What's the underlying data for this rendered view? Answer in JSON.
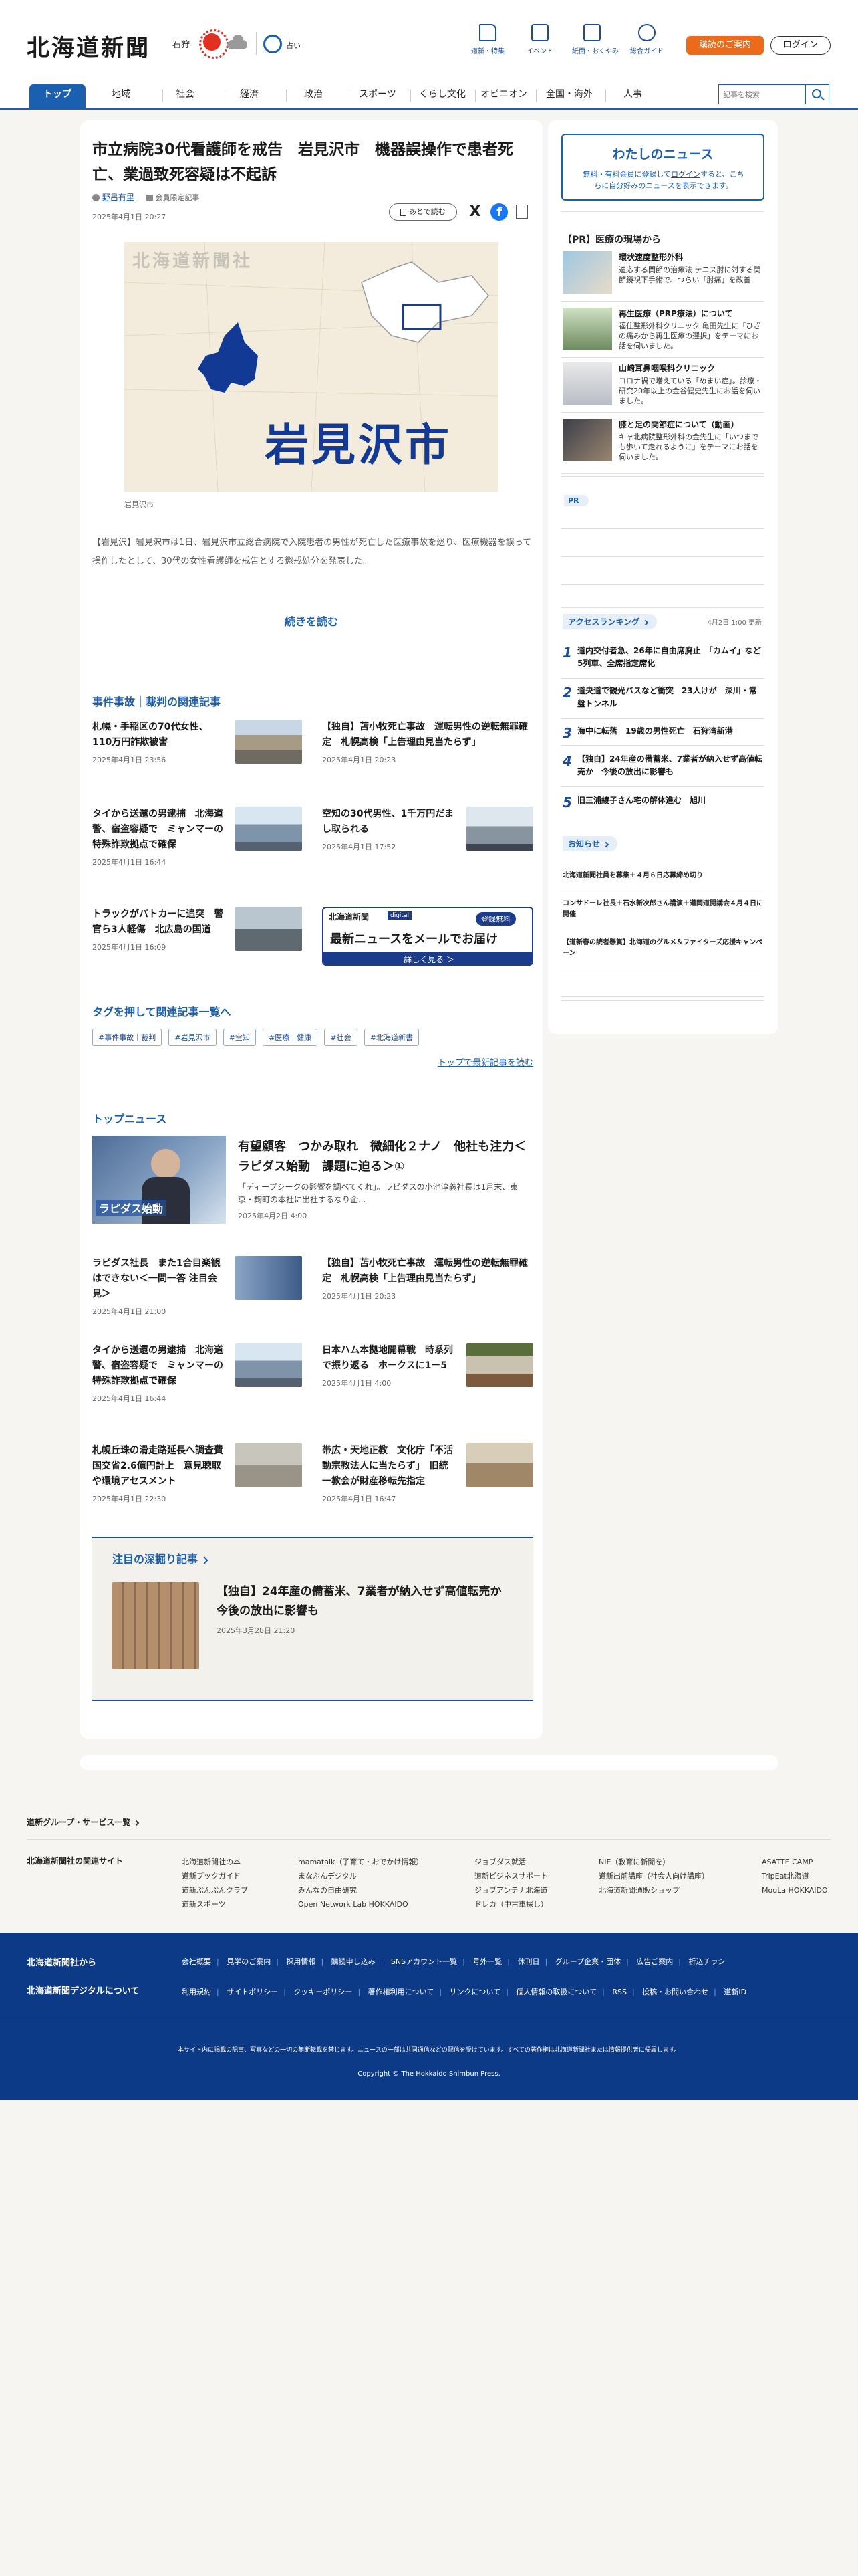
{
  "header": {
    "logo": "北海道新聞",
    "city": "石狩",
    "fortune": "占い",
    "icons": [
      "道新・特集",
      "イベント",
      "紙面・おくやみ",
      "総合ガイド"
    ],
    "subscribe": "購読のご案内",
    "login": "ログイン"
  },
  "nav": {
    "items": [
      "トップ",
      "地域",
      "社会",
      "経済",
      "政治",
      "スポーツ",
      "くらし文化",
      "オピニオン",
      "全国・海外",
      "人事"
    ],
    "search_placeholder": "記事を検索"
  },
  "article": {
    "title": "市立病院30代看護師を戒告　岩見沢市　機器誤操作で患者死亡、業過致死容疑は不起訴",
    "author": "野呂有里",
    "member": "会員限定記事",
    "date": "2025年4月1日 20:27",
    "save": "あとで読む",
    "image_watermark": "北海道新聞社",
    "image_text": "岩見沢市",
    "caption": "岩見沢市",
    "lead": "【岩見沢】岩見沢市は1日、岩見沢市立総合病院で入院患者の男性が死亡した医療事故を巡り、医療機器を誤って操作したとして、30代の女性看護師を戒告とする懲戒処分を発表した。",
    "read_more": "続きを読む"
  },
  "related": {
    "heading": "事件事故｜裁判の関連記事",
    "items": [
      {
        "title": "札幌・手稲区の70代女性、110万円詐欺被害",
        "date": "2025年4月1日 23:56"
      },
      {
        "title": "【独自】苫小牧死亡事故　運転男性の逆転無罪確定　札幌高検「上告理由見当たらず」",
        "date": "2025年4月1日 20:23"
      },
      {
        "title": "タイから送還の男逮捕　北海道警、宿盗容疑で　ミャンマーの特殊詐欺拠点で確保",
        "date": "2025年4月1日 16:44"
      },
      {
        "title": "空知の30代男性、1千万円だまし取られる",
        "date": "2025年4月1日 17:52"
      },
      {
        "title": "トラックがパトカーに追突　警官ら3人軽傷　北広島の国道",
        "date": "2025年4月1日 16:09"
      }
    ],
    "banner_logo": "北海道新聞",
    "banner_tag": "digital",
    "banner_badge": "登録無料",
    "banner_title": "最新ニュースをメールでお届け",
    "banner_btn": "詳しく見る ＞"
  },
  "tags": {
    "heading": "タグを押して関連記事一覧へ",
    "items": [
      "#事件事故｜裁判",
      "#岩見沢市",
      "#空知",
      "#医療｜健康",
      "#社会",
      "#北海道新書"
    ],
    "more": "トップで最新記事を読む"
  },
  "top_news": {
    "heading": "トップニュース",
    "lead_title": "有望顧客　つかみ取れ　微細化２ナノ　他社も注力＜ラピダス始動　課題に迫る＞①",
    "lead_text": "「ディープシークの影響を調べてくれ」。ラピダスの小池淳義社長は1月末、東京・麹町の本社に出社するなり企...",
    "lead_date": "2025年4月2日 4:00",
    "thumb_text": "ラピダス始動",
    "items": [
      {
        "title": "ラピダス社長　また1合目楽観はできない＜一問一答 注目会見＞",
        "date": "2025年4月1日 21:00"
      },
      {
        "title": "【独自】苫小牧死亡事故　運転男性の逆転無罪確定　札幌高検「上告理由見当たらず」",
        "date": "2025年4月1日 20:23"
      },
      {
        "title": "タイから送還の男逮捕　北海道警、宿盗容疑で　ミャンマーの特殊詐欺拠点で確保",
        "date": "2025年4月1日 16:44"
      },
      {
        "title": "日本ハム本拠地開幕戦　時系列で振り返る　ホークスに1－5",
        "date": "2025年4月1日 4:00"
      },
      {
        "title": "札幌丘珠の滑走路延長へ調査費　国交省2.6億円計上　意見聴取や環境アセスメント",
        "date": "2025年4月1日 22:30"
      },
      {
        "title": "帯広・天地正教　文化庁「不活動宗教法人に当たらず」　旧統一教会が財産移転先指定",
        "date": "2025年4月1日 16:47"
      }
    ]
  },
  "deep": {
    "heading": "注目の深掘り記事",
    "title": "【独自】24年産の備蓄米、7業者が納入せず高値転売か　今後の放出に影響も",
    "date": "2025年3月28日 21:20"
  },
  "sidebar": {
    "my_news_title": "わたしのニュース",
    "my_news_text1": "無料・有料会員に登録して",
    "my_news_login": "ログイン",
    "my_news_text2": "すると、こちらに自分好みのニュースを表示できます。",
    "pr_heading": "【PR】医療の現場から",
    "pr_items": [
      {
        "name": "環状速度整形外科",
        "desc": "適応する関節の治療法 テニス肘に対する関節鏡視下手術で、つらい「肘痛」を改善"
      },
      {
        "name": "再生医療（PRP療法）について",
        "desc": "福住整形外科クリニック 亀田先生に「ひざの痛みから再生医療の選択」をテーマにお話を伺いました。"
      },
      {
        "name": "山崎耳鼻咽喉科クリニック",
        "desc": "コロナ禍で増えている「めまい症」。診療・研究20年以上の金谷健史先生にお話を伺いました。"
      },
      {
        "name": "膝と足の関節症について（動画）",
        "desc": "キャ北病院整形外科の金先生に「いつまでも歩いて走れるように」をテーマにお話を伺いました。"
      }
    ],
    "pr_label": "PR",
    "ranking_heading": "アクセスランキング",
    "ranking_date": "4月2日 1:00 更新",
    "ranking": [
      "道内交付者急、26年に自由席廃止　「カムイ」など5列車、全席指定席化",
      "道央道で観光バスなど衝突　23人けが　深川・常盤トンネル",
      "海中に転落　19歳の男性死亡　石狩湾新港",
      "【独自】24年産の備蓄米、7業者が納入せず高値転売か　今後の放出に影響も",
      "旧三浦綾子さん宅の解体進む　旭川"
    ],
    "notice_heading": "お知らせ",
    "notices": [
      "北海道新聞社員を募集＋４月６日応募締め切り",
      "コンサドーレ社長＋石水新次郎さん講演＋道岡道開講会４月４日に開催",
      "【道新春の読者懸賞】北海道のグルメ＆ファイターズ応援キャンペーン"
    ]
  },
  "footer": {
    "group_link": "道新グループ・サービス一覧",
    "related_heading": "北海道新聞社の関連サイト",
    "related_cols": [
      [
        "北海道新聞社の本",
        "道新ブックガイド",
        "道新ぶんぶんクラブ",
        "道新スポーツ"
      ],
      [
        "mamatalk（子育て・おでかけ情報）",
        "まなぶんデジタル",
        "みんなの自由研究",
        "Open Network Lab HOKKAIDO"
      ],
      [
        "ジョブダス就活",
        "道新ビジネスサポート",
        "ジョブアンテナ北海道",
        "ドレカ（中古車探し）"
      ],
      [
        "NIE（教育に新聞を）",
        "道新出前講座（社会人向け講座）",
        "北海道新聞通販ショップ"
      ],
      [
        "ASATTE CAMP",
        "TripEat北海道",
        "MouLa HOKKAIDO"
      ]
    ],
    "from_heading": "北海道新聞社から",
    "digital_heading": "北海道新聞デジタルについて",
    "links1": [
      "会社概要",
      "見学のご案内",
      "採用情報",
      "購読申し込み",
      "SNSアカウント一覧",
      "号外一覧",
      "休刊日",
      "グループ企業・団体",
      "広告ご案内",
      "折込チラシ"
    ],
    "links2": [
      "利用規約",
      "サイトポリシー",
      "クッキーポリシー",
      "著作権利用について",
      "リンクについて",
      "個人情報の取扱について",
      "RSS",
      "投稿・お問い合わせ",
      "道新ID"
    ],
    "notice": "本サイト内に掲載の記事、写真などの一切の無断転載を禁じます。ニュースの一部は共同通信などの配信を受けています。すべての著作権は北海道新聞社または情報提供者に帰属します。",
    "copyright": "Copyright © The Hokkaido Shimbun Press."
  }
}
